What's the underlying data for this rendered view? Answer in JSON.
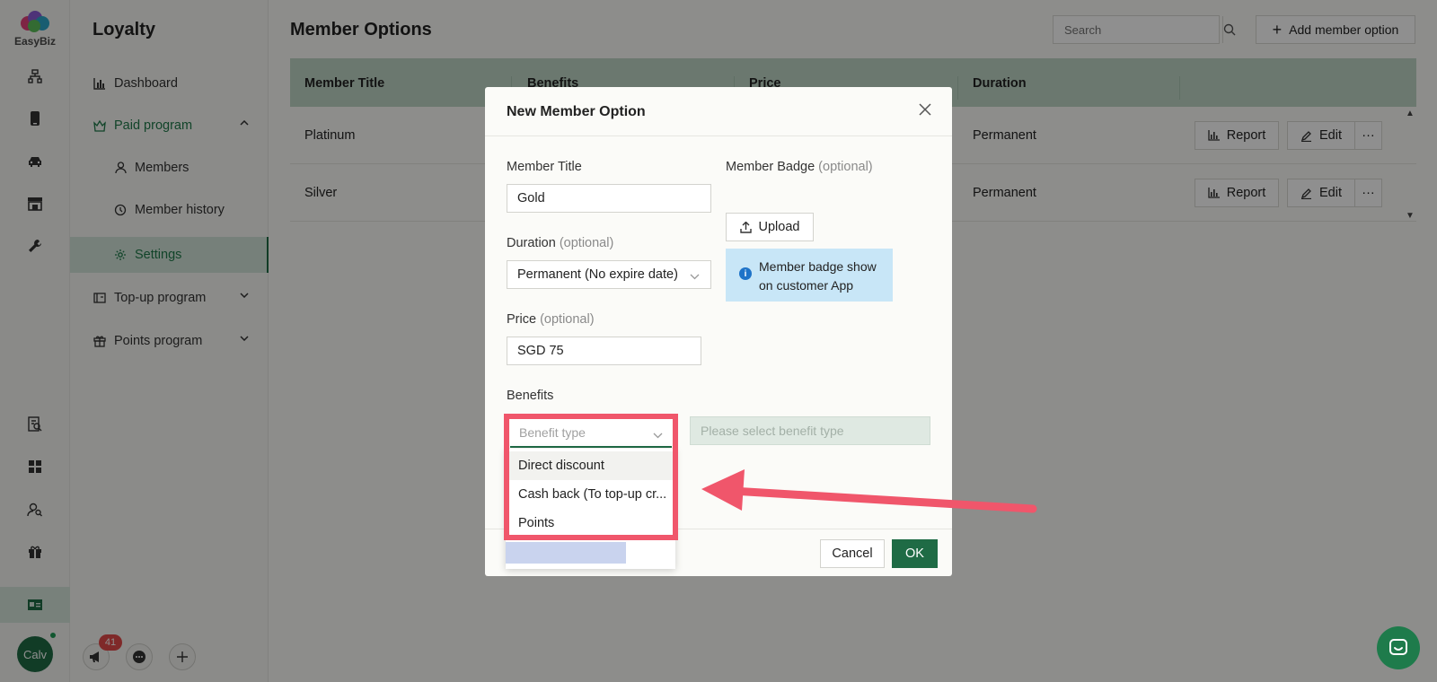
{
  "brand": {
    "name": "EasyBiz"
  },
  "user": {
    "avatar_initials": "Calv"
  },
  "notifications": {
    "count": "41"
  },
  "subnav": {
    "title": "Loyalty",
    "items": [
      {
        "label": "Dashboard"
      },
      {
        "label": "Paid program"
      },
      {
        "label": "Members"
      },
      {
        "label": "Member history"
      },
      {
        "label": "Settings"
      },
      {
        "label": "Top-up program"
      },
      {
        "label": "Points program"
      }
    ]
  },
  "page": {
    "title": "Member Options",
    "search_placeholder": "Search",
    "add_button": "Add member option"
  },
  "table": {
    "columns": [
      "Member Title",
      "Benefits",
      "Price",
      "Duration"
    ],
    "rows": [
      {
        "title": "Platinum",
        "duration": "Permanent"
      },
      {
        "title": "Silver",
        "duration": "Permanent"
      }
    ],
    "row_actions": {
      "report": "Report",
      "edit": "Edit",
      "more": "···"
    }
  },
  "modal": {
    "title": "New Member Option",
    "member_title_label": "Member Title",
    "member_title_value": "Gold",
    "badge_label": "Member Badge",
    "optional": "(optional)",
    "upload_label": "Upload",
    "badge_info": "Member badge show on customer App",
    "duration_label": "Duration",
    "duration_value": "Permanent (No expire date)",
    "price_label": "Price",
    "price_value": "SGD 75",
    "benefits_label": "Benefits",
    "benefit_type_placeholder": "Benefit type",
    "benefit_value_placeholder": "Please select benefit type",
    "cancel_label": "Cancel",
    "ok_label": "OK"
  },
  "benefit_dropdown": {
    "options": [
      "Direct discount",
      "Cash back (To top-up cr...",
      "Points"
    ]
  },
  "colors": {
    "brand_green": "#1f6b45",
    "header_green": "#bfd6c7",
    "highlight_red": "#f0566b",
    "info_blue": "#c8e6f7"
  }
}
